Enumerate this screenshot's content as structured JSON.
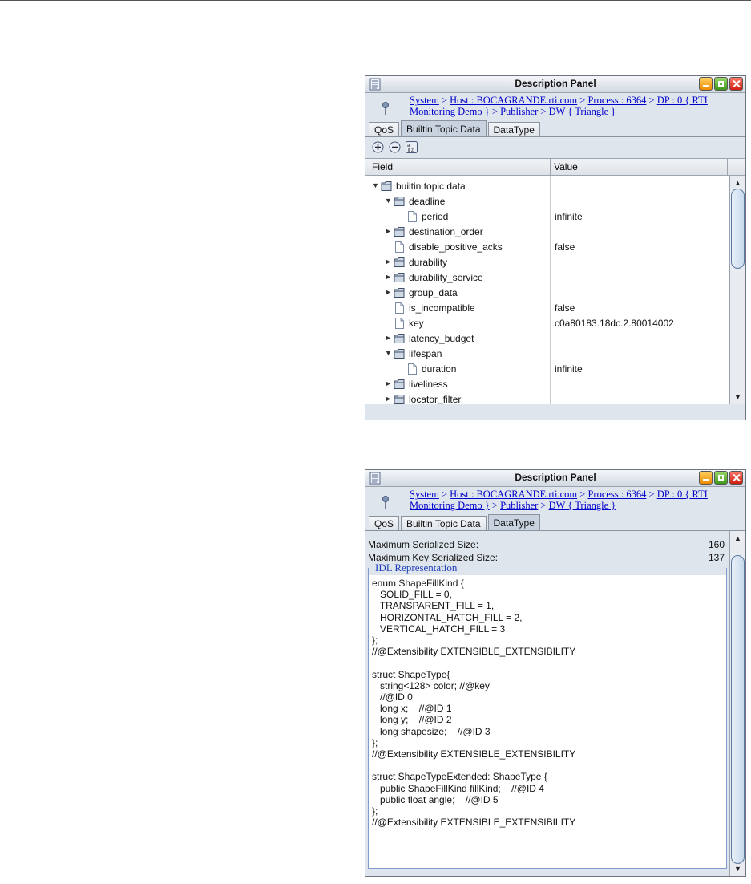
{
  "panel_title": "Description Panel",
  "breadcrumb": {
    "system": "System",
    "host": "Host : BOCAGRANDE.rti.com",
    "process": "Process : 6364",
    "dp": "DP : 0 { RTI Monitoring Demo }",
    "publisher": "Publisher",
    "dw": "DW { Triangle }",
    "separator": ">"
  },
  "tabs": {
    "qos": "QoS",
    "builtin": "Builtin Topic Data",
    "datatype": "DataType"
  },
  "tree": {
    "col_field": "Field",
    "col_value": "Value",
    "rows": [
      {
        "label": "builtin topic data",
        "value": "",
        "kind": "folder",
        "expanded": true,
        "depth": 0
      },
      {
        "label": "deadline",
        "value": "",
        "kind": "folder",
        "expanded": true,
        "depth": 1
      },
      {
        "label": "period",
        "value": "infinite",
        "kind": "file",
        "depth": 2
      },
      {
        "label": "destination_order",
        "value": "",
        "kind": "folder",
        "expanded": false,
        "depth": 1
      },
      {
        "label": "disable_positive_acks",
        "value": "false",
        "kind": "file",
        "depth": 1
      },
      {
        "label": "durability",
        "value": "",
        "kind": "folder",
        "expanded": false,
        "depth": 1
      },
      {
        "label": "durability_service",
        "value": "",
        "kind": "folder",
        "expanded": false,
        "depth": 1
      },
      {
        "label": "group_data",
        "value": "",
        "kind": "folder",
        "expanded": false,
        "depth": 1
      },
      {
        "label": "is_incompatible",
        "value": "false",
        "kind": "file",
        "depth": 1
      },
      {
        "label": "key",
        "value": "c0a80183.18dc.2.80014002",
        "kind": "file",
        "depth": 1
      },
      {
        "label": "latency_budget",
        "value": "",
        "kind": "folder",
        "expanded": false,
        "depth": 1
      },
      {
        "label": "lifespan",
        "value": "",
        "kind": "folder",
        "expanded": true,
        "depth": 1
      },
      {
        "label": "duration",
        "value": "infinite",
        "kind": "file",
        "depth": 2
      },
      {
        "label": "liveliness",
        "value": "",
        "kind": "folder",
        "expanded": false,
        "depth": 1
      },
      {
        "label": "locator_filter",
        "value": "",
        "kind": "folder",
        "expanded": false,
        "depth": 1
      }
    ]
  },
  "datatype": {
    "max_serialized_label": "Maximum Serialized Size:",
    "max_serialized_value": "160",
    "max_key_label": "Maximum Key Serialized Size:",
    "max_key_value": "137",
    "idl_legend": "IDL Representation",
    "idl_lines": [
      "enum ShapeFillKind {",
      "   SOLID_FILL = 0,",
      "   TRANSPARENT_FILL = 1,",
      "   HORIZONTAL_HATCH_FILL = 2,",
      "   VERTICAL_HATCH_FILL = 3",
      "};",
      "//@Extensibility EXTENSIBLE_EXTENSIBILITY",
      "",
      "struct ShapeType{",
      "   string<128> color; //@key",
      "   //@ID 0",
      "   long x;    //@ID 1",
      "   long y;    //@ID 2",
      "   long shapesize;    //@ID 3",
      "};",
      "//@Extensibility EXTENSIBLE_EXTENSIBILITY",
      "",
      "struct ShapeTypeExtended: ShapeType {",
      "   public ShapeFillKind fillKind;    //@ID 4",
      "   public float angle;    //@ID 5",
      "};",
      "//@Extensibility EXTENSIBLE_EXTENSIBILITY"
    ]
  },
  "colors": {
    "link": "#0000cc",
    "panel_bg": "#dfe5ec",
    "legend": "#1d3fb8",
    "close": "#d01e10",
    "maximize": "#3d9a18",
    "minimize": "#f08a00"
  }
}
